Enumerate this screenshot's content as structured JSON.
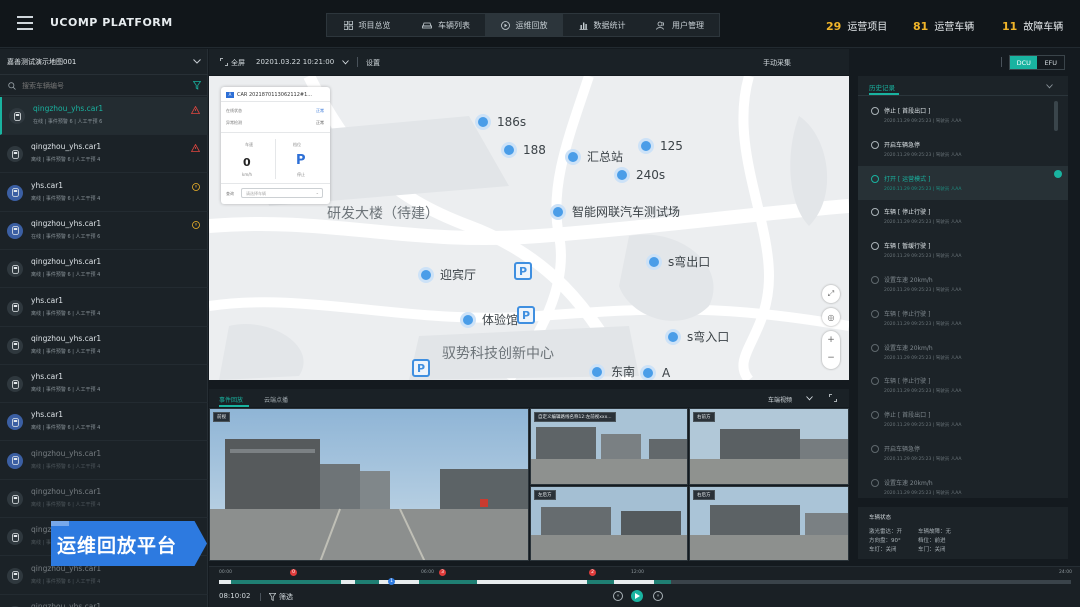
{
  "header": {
    "brand": "UCOMP PLATFORM",
    "nav": [
      {
        "label": "项目总览",
        "icon": "grid-icon"
      },
      {
        "label": "车辆列表",
        "icon": "car-icon"
      },
      {
        "label": "运维回放",
        "icon": "play-circle-icon"
      },
      {
        "label": "数据统计",
        "icon": "bar-chart-icon"
      },
      {
        "label": "用户管理",
        "icon": "users-icon"
      }
    ],
    "stats": [
      {
        "num": "29",
        "label": "运营项目"
      },
      {
        "num": "81",
        "label": "运营车辆"
      },
      {
        "num": "11",
        "label": "故障车辆"
      }
    ]
  },
  "sidebar": {
    "map_select": "嘉善测试演示地图001",
    "search_placeholder": "搜索车辆编号",
    "cars": [
      {
        "name": "qingzhou_yhs.car1",
        "sub": "在线 | 事件预警 6 | 人工干预 6",
        "flag": "warn-red"
      },
      {
        "name": "qingzhou_yhs.car1",
        "sub": "离线 | 事件预警 6 | 人工干预 4",
        "flag": "warn-red"
      },
      {
        "name": "yhs.car1",
        "sub": "离线 | 事件预警 6 | 人工干预 4",
        "flag": "alert-yellow"
      },
      {
        "name": "qingzhou_yhs.car1",
        "sub": "在线 | 事件预警 6 | 人工干预 6",
        "flag": "alert-yellow"
      },
      {
        "name": "qingzhou_yhs.car1",
        "sub": "离线 | 事件预警 6 | 人工干预 4",
        "flag": ""
      },
      {
        "name": "yhs.car1",
        "sub": "离线 | 事件预警 6 | 人工干预 4",
        "flag": ""
      },
      {
        "name": "qingzhou_yhs.car1",
        "sub": "离线 | 事件预警 6 | 人工干预 4",
        "flag": ""
      },
      {
        "name": "yhs.car1",
        "sub": "离线 | 事件预警 6 | 人工干预 4",
        "flag": ""
      },
      {
        "name": "yhs.car1",
        "sub": "离线 | 事件预警 6 | 人工干预 4",
        "flag": ""
      },
      {
        "name": "qingzhou_yhs.car1",
        "sub": "离线 | 事件预警 6 | 人工干预 4",
        "flag": ""
      },
      {
        "name": "qingzhou_yhs.car1",
        "sub": "离线 | 事件预警 6 | 人工干预 4",
        "flag": ""
      },
      {
        "name": "qingzhou_yhs.car1",
        "sub": "离线 | 事件预警 6 | 人工干预 4",
        "flag": ""
      },
      {
        "name": "qingzhou_yhs.car1",
        "sub": "离线 | 事件预警 6 | 人工干预 4",
        "flag": ""
      },
      {
        "name": "qingzhou_yhs.car1",
        "sub": "离线 | 事件预警 6 | 人工干预 4",
        "flag": ""
      }
    ],
    "promo": "运维回放平台"
  },
  "toolbar": {
    "fullscreen": "全屏",
    "datetime": "20201.03.22 10:21:00",
    "settings": "设置",
    "collect": "手动采集",
    "dcu": "DCU",
    "efu": "EFU"
  },
  "map": {
    "pois": [
      {
        "label": "186s"
      },
      {
        "label": "188"
      },
      {
        "label": "汇总站"
      },
      {
        "label": "125"
      },
      {
        "label": "240s"
      },
      {
        "label": "智能网联汽车测试场"
      },
      {
        "label": "迎宾厅"
      },
      {
        "label": "s弯出口"
      },
      {
        "label": "体验馆"
      },
      {
        "label": "s弯入口"
      },
      {
        "label": "东南"
      },
      {
        "label": "A"
      }
    ],
    "places": [
      "研发大楼（待建）",
      "驭势科技创新中心"
    ],
    "park": "P"
  },
  "card": {
    "car": "CAR 2021870113062112#1...",
    "row1_label": "在线状态",
    "row1_value": "正常",
    "row2_label": "异常检测",
    "row2_value": "正常",
    "speed_label": "车速",
    "speed_value": "0",
    "speed_unit": "km/h",
    "gear_label": "档位",
    "gear_value": "P",
    "gear_sub": "停止",
    "dropdown_label": "查询",
    "dropdown_placeholder": "请选择车辆"
  },
  "video": {
    "tab_active": "事件回放",
    "tab_other": "云端点播",
    "camera_select": "车端视频",
    "cams": [
      "前视",
      "自定义编辑路线名称12:左前视xxx...",
      "右前方",
      "左后方",
      "右后方"
    ]
  },
  "history": {
    "title": "历史记录",
    "items": [
      {
        "title": "停止 [ 首段出口 ]",
        "sub": "2020.11.29 09:25:23 | 驾驶员 人AA",
        "dim": false,
        "on": false
      },
      {
        "title": "开启车辆急停",
        "sub": "2020.11.29 09:25:23 | 驾驶员 人AA",
        "dim": false,
        "on": false
      },
      {
        "title": "打开 [ 运营模式 ]",
        "sub": "2020.11.29 09:25:23 | 驾驶员 人AA",
        "dim": false,
        "on": true
      },
      {
        "title": "车辆 [ 停止行驶 ]",
        "sub": "2020.11.29 09:25:23 | 驾驶员 人AA",
        "dim": false,
        "on": false
      },
      {
        "title": "车辆 [ 暂缓行驶 ]",
        "sub": "2020.11.29 09:25:23 | 驾驶员 人AA",
        "dim": false,
        "on": false
      },
      {
        "title": "设置车速 20km/h",
        "sub": "2020.11.29 09:25:23 | 驾驶员 人AA",
        "dim": true,
        "on": false
      },
      {
        "title": "车辆 [ 停止行驶 ]",
        "sub": "2020.11.29 09:25:23 | 驾驶员 人AA",
        "dim": true,
        "on": false
      },
      {
        "title": "设置车速 20km/h",
        "sub": "2020.11.29 09:25:23 | 驾驶员 人AA",
        "dim": true,
        "on": false
      },
      {
        "title": "车辆 [ 停止行驶 ]",
        "sub": "2020.11.29 09:25:23 | 驾驶员 人AA",
        "dim": true,
        "on": false
      },
      {
        "title": "停止 [ 首段出口 ]",
        "sub": "2020.11.29 09:25:23 | 驾驶员 人AA",
        "dim": true,
        "on": false
      },
      {
        "title": "开启车辆急停",
        "sub": "2020.11.29 09:25:23 | 驾驶员 人AA",
        "dim": true,
        "on": false
      },
      {
        "title": "设置车速 20km/h",
        "sub": "2020.11.29 09:25:23 | 驾驶员 人AA",
        "dim": true,
        "on": false
      }
    ]
  },
  "vehicle_info": {
    "title": "车辆状态",
    "rows": [
      "激光雷达：开",
      "车辆故障：无",
      "方向盘：90°",
      "档位：前进",
      "车灯：关闭",
      "车门：关闭"
    ]
  },
  "timeline": {
    "ticks": [
      "00:00",
      "06:00",
      "12:00",
      "24:00"
    ],
    "current_time": "08:10:02",
    "filter": "筛选",
    "events": [
      "0",
      "1",
      "3",
      "2"
    ]
  }
}
